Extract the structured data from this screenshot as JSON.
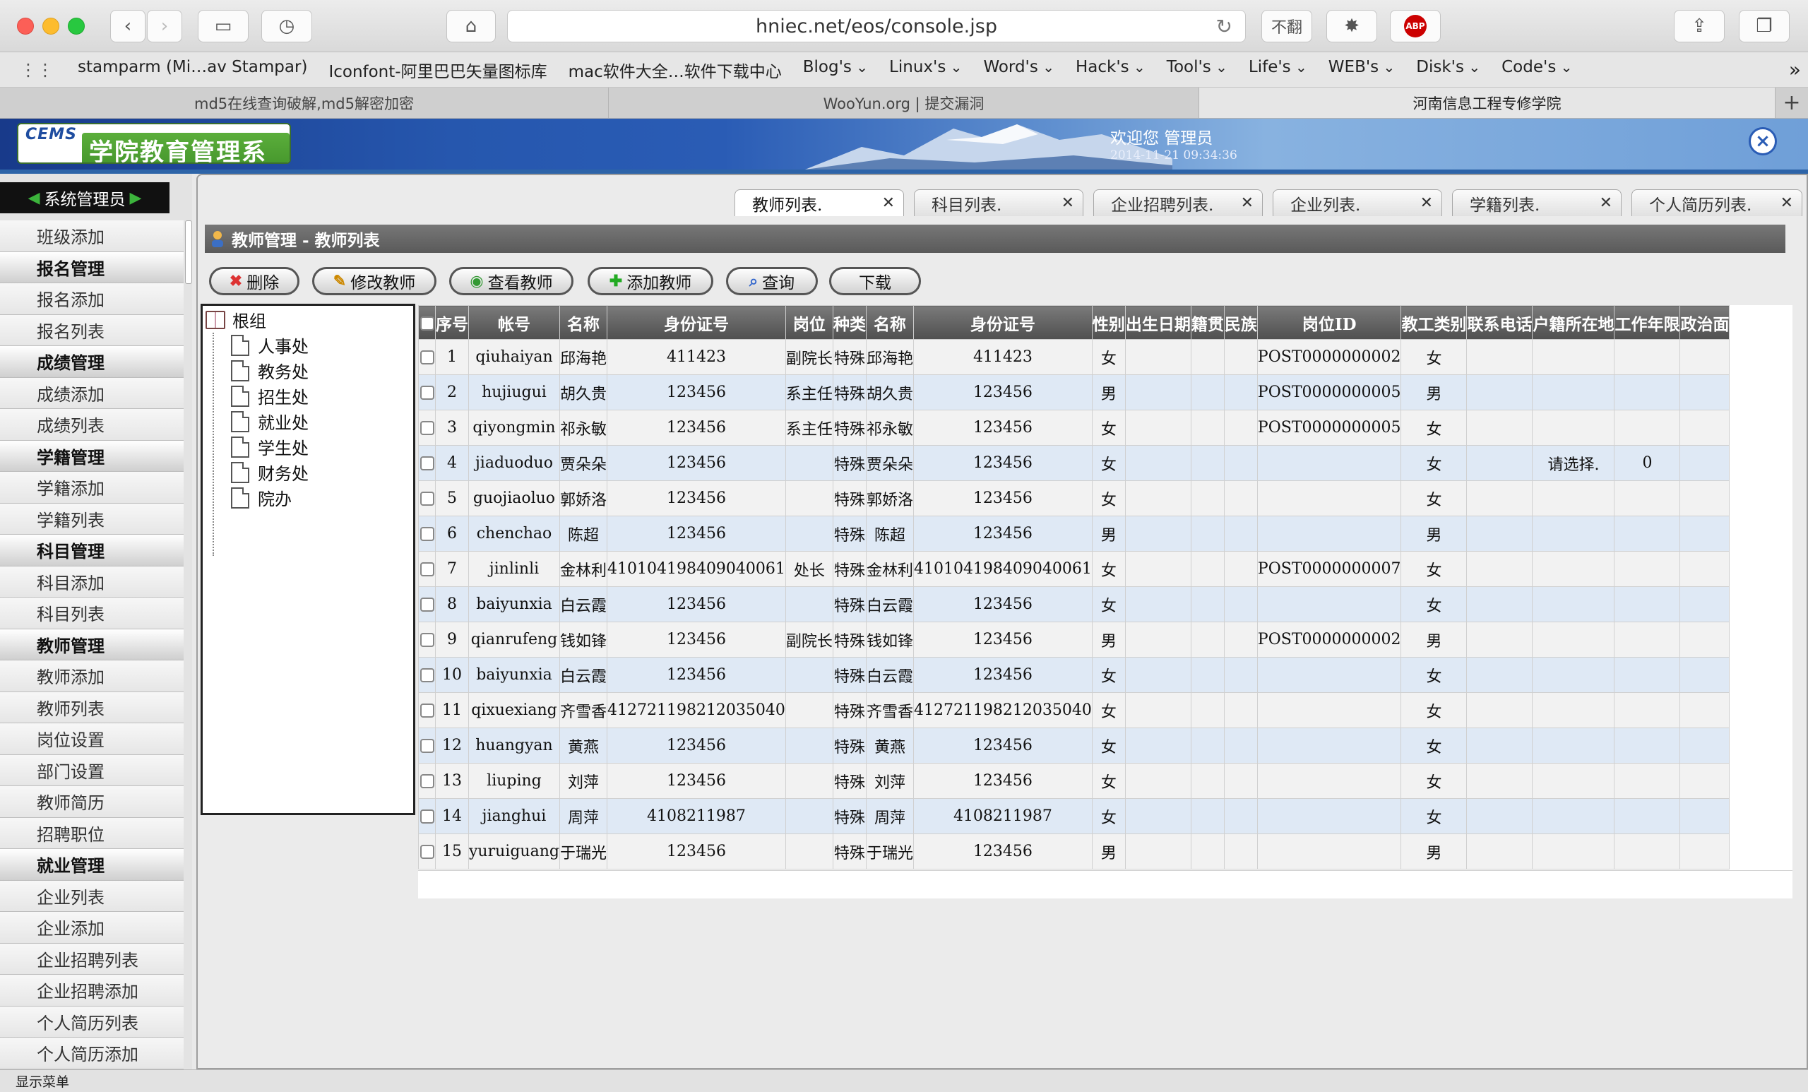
{
  "browser": {
    "url": "hniec.net/eos/console.jsp",
    "ext_labels": [
      "不翻",
      "ABP"
    ],
    "bookmarks": [
      {
        "label": "stamparm (Mi…av Stampar)",
        "dd": false
      },
      {
        "label": "Iconfont-阿里巴巴矢量图标库",
        "dd": false
      },
      {
        "label": "mac软件大全…软件下载中心",
        "dd": false
      },
      {
        "label": "Blog's",
        "dd": true
      },
      {
        "label": "Linux's",
        "dd": true
      },
      {
        "label": "Word's",
        "dd": true
      },
      {
        "label": "Hack's",
        "dd": true
      },
      {
        "label": "Tool's",
        "dd": true
      },
      {
        "label": "Life's",
        "dd": true
      },
      {
        "label": "WEB's",
        "dd": true
      },
      {
        "label": "Disk's",
        "dd": true
      },
      {
        "label": "Code's",
        "dd": true
      }
    ],
    "tabs": [
      "md5在线查询破解,md5解密加密",
      "WooYun.org | 提交漏洞",
      "河南信息工程专修学院"
    ],
    "active_tab": 2
  },
  "app": {
    "logo_prefix": "CEMS",
    "logo_title": "学院教育管理系统",
    "welcome": "欢迎您 管理员",
    "datetime": "2014-11-21 09:34:36"
  },
  "sidebar": {
    "role": "系统管理员",
    "items": [
      {
        "label": "班级添加",
        "hdr": false
      },
      {
        "label": "报名管理",
        "hdr": true
      },
      {
        "label": "报名添加",
        "hdr": false
      },
      {
        "label": "报名列表",
        "hdr": false
      },
      {
        "label": "成绩管理",
        "hdr": true
      },
      {
        "label": "成绩添加",
        "hdr": false
      },
      {
        "label": "成绩列表",
        "hdr": false
      },
      {
        "label": "学籍管理",
        "hdr": true
      },
      {
        "label": "学籍添加",
        "hdr": false
      },
      {
        "label": "学籍列表",
        "hdr": false
      },
      {
        "label": "科目管理",
        "hdr": true
      },
      {
        "label": "科目添加",
        "hdr": false
      },
      {
        "label": "科目列表",
        "hdr": false
      },
      {
        "label": "教师管理",
        "hdr": true
      },
      {
        "label": "教师添加",
        "hdr": false
      },
      {
        "label": "教师列表",
        "hdr": false
      },
      {
        "label": "岗位设置",
        "hdr": false
      },
      {
        "label": "部门设置",
        "hdr": false
      },
      {
        "label": "教师简历",
        "hdr": false
      },
      {
        "label": "招聘职位",
        "hdr": false
      },
      {
        "label": "就业管理",
        "hdr": true
      },
      {
        "label": "企业列表",
        "hdr": false
      },
      {
        "label": "企业添加",
        "hdr": false
      },
      {
        "label": "企业招聘列表",
        "hdr": false
      },
      {
        "label": "企业招聘添加",
        "hdr": false
      },
      {
        "label": "个人简历列表",
        "hdr": false
      },
      {
        "label": "个人简历添加",
        "hdr": false
      }
    ]
  },
  "panel": {
    "tabs": [
      "教师列表.",
      "科目列表.",
      "企业招聘列表.",
      "企业列表.",
      "学籍列表.",
      "个人简历列表."
    ],
    "title": "教师管理 - 教师列表",
    "actions": [
      {
        "label": "删除",
        "icon": "delete-icon",
        "glyph": "✖",
        "color": "#d33"
      },
      {
        "label": "修改教师",
        "icon": "pencil-icon",
        "glyph": "✎",
        "color": "#c80"
      },
      {
        "label": "查看教师",
        "icon": "eye-icon",
        "glyph": "◉",
        "color": "#393"
      },
      {
        "label": "添加教师",
        "icon": "plus-icon",
        "glyph": "✚",
        "color": "#2a2"
      },
      {
        "label": "查询",
        "icon": "magnifier-icon",
        "glyph": "⌕",
        "color": "#36c"
      },
      {
        "label": "下载",
        "icon": "",
        "glyph": "",
        "color": "#333"
      }
    ],
    "tree": {
      "root": "根组",
      "children": [
        "人事处",
        "教务处",
        "招生处",
        "就业处",
        "学生处",
        "财务处",
        "院办"
      ]
    }
  },
  "grid": {
    "columns": [
      "",
      "序号",
      "帐号",
      "名称",
      "身份证号",
      "岗位",
      "种类",
      "名称",
      "身份证号",
      "性别",
      "出生日期",
      "籍贯",
      "民族",
      "岗位ID",
      "教工类别",
      "联系电话",
      "户籍所在地",
      "工作年限",
      "政治面"
    ],
    "rows": [
      [
        "1",
        "qiuhaiyan",
        "邱海艳",
        "411423",
        "副院长",
        "特殊",
        "邱海艳",
        "411423",
        "女",
        "",
        "",
        "",
        "POST0000000002",
        "女",
        "",
        "",
        "",
        ""
      ],
      [
        "2",
        "hujiugui",
        "胡久贵",
        "123456",
        "系主任",
        "特殊",
        "胡久贵",
        "123456",
        "男",
        "",
        "",
        "",
        "POST0000000005",
        "男",
        "",
        "",
        "",
        ""
      ],
      [
        "3",
        "qiyongmin",
        "祁永敏",
        "123456",
        "系主任",
        "特殊",
        "祁永敏",
        "123456",
        "女",
        "",
        "",
        "",
        "POST0000000005",
        "女",
        "",
        "",
        "",
        ""
      ],
      [
        "4",
        "jiaduoduo",
        "贾朵朵",
        "123456",
        "",
        "特殊",
        "贾朵朵",
        "123456",
        "女",
        "",
        "",
        "",
        "",
        "女",
        "",
        "请选择.",
        "0",
        ""
      ],
      [
        "5",
        "guojiaoluo",
        "郭娇洛",
        "123456",
        "",
        "特殊",
        "郭娇洛",
        "123456",
        "女",
        "",
        "",
        "",
        "",
        "女",
        "",
        "",
        "",
        ""
      ],
      [
        "6",
        "chenchao",
        "陈超",
        "123456",
        "",
        "特殊",
        "陈超",
        "123456",
        "男",
        "",
        "",
        "",
        "",
        "男",
        "",
        "",
        "",
        ""
      ],
      [
        "7",
        "jinlinli",
        "金林利",
        "410104198409040061",
        "处长",
        "特殊",
        "金林利",
        "410104198409040061",
        "女",
        "",
        "",
        "",
        "POST0000000007",
        "女",
        "",
        "",
        "",
        ""
      ],
      [
        "8",
        "baiyunxia",
        "白云霞",
        "123456",
        "",
        "特殊",
        "白云霞",
        "123456",
        "女",
        "",
        "",
        "",
        "",
        "女",
        "",
        "",
        "",
        ""
      ],
      [
        "9",
        "qianrufeng",
        "钱如锋",
        "123456",
        "副院长",
        "特殊",
        "钱如锋",
        "123456",
        "男",
        "",
        "",
        "",
        "POST0000000002",
        "男",
        "",
        "",
        "",
        ""
      ],
      [
        "10",
        "baiyunxia",
        "白云霞",
        "123456",
        "",
        "特殊",
        "白云霞",
        "123456",
        "女",
        "",
        "",
        "",
        "",
        "女",
        "",
        "",
        "",
        ""
      ],
      [
        "11",
        "qixuexiang",
        "齐雪香",
        "412721198212035040",
        "",
        "特殊",
        "齐雪香",
        "412721198212035040",
        "女",
        "",
        "",
        "",
        "",
        "女",
        "",
        "",
        "",
        ""
      ],
      [
        "12",
        "huangyan",
        "黄燕",
        "123456",
        "",
        "特殊",
        "黄燕",
        "123456",
        "女",
        "",
        "",
        "",
        "",
        "女",
        "",
        "",
        "",
        ""
      ],
      [
        "13",
        "liuping",
        "刘萍",
        "123456",
        "",
        "特殊",
        "刘萍",
        "123456",
        "女",
        "",
        "",
        "",
        "",
        "女",
        "",
        "",
        "",
        ""
      ],
      [
        "14",
        "jianghui",
        "周萍",
        "4108211987",
        "",
        "特殊",
        "周萍",
        "4108211987",
        "女",
        "",
        "",
        "",
        "",
        "女",
        "",
        "",
        "",
        ""
      ],
      [
        "15",
        "yuruiguang",
        "于瑞光",
        "123456",
        "",
        "特殊",
        "于瑞光",
        "123456",
        "男",
        "",
        "",
        "",
        "",
        "男",
        "",
        "",
        "",
        ""
      ]
    ]
  },
  "status": {
    "text": "显示菜单"
  },
  "colors": {
    "accent": "#2a5cb5",
    "header_gray": "#5a5a5a",
    "row_blue": "#dfe9f5",
    "row_gray": "#f2f2f2"
  }
}
